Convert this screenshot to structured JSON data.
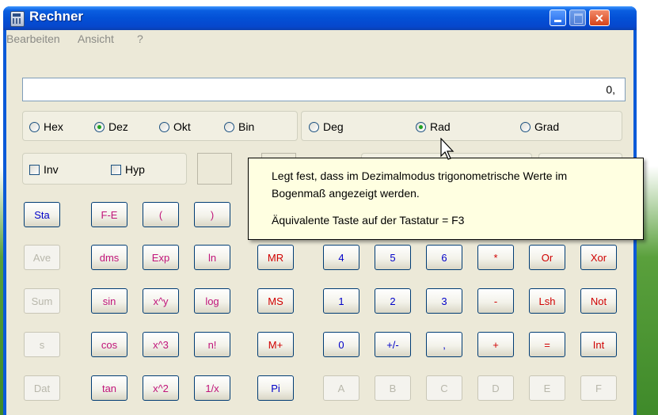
{
  "window": {
    "title": "Rechner"
  },
  "menu": [
    "Bearbeiten",
    "Ansicht",
    "?"
  ],
  "display_value": "0,",
  "number_system": {
    "options": [
      "Hex",
      "Dez",
      "Okt",
      "Bin"
    ],
    "selected": "Dez"
  },
  "angle_unit": {
    "options": [
      "Deg",
      "Rad",
      "Grad"
    ],
    "selected": "Rad"
  },
  "checkboxes": [
    "Inv",
    "Hyp"
  ],
  "buttons": {
    "stat_column": [
      "Sta",
      "Ave",
      "Sum",
      "s",
      "Dat"
    ],
    "func_row1": [
      "F-E",
      "(",
      ")"
    ],
    "func_row2": [
      "dms",
      "Exp",
      "ln"
    ],
    "func_row3": [
      "sin",
      "x^y",
      "log"
    ],
    "func_row4": [
      "cos",
      "x^3",
      "n!"
    ],
    "func_row5": [
      "tan",
      "x^2",
      "1/x"
    ],
    "memory": [
      "MR",
      "MS",
      "M+",
      "Pi"
    ],
    "digits_row1": [
      "4",
      "5",
      "6",
      "*",
      "Or",
      "Xor"
    ],
    "digits_row2": [
      "1",
      "2",
      "3",
      "-",
      "Lsh",
      "Not"
    ],
    "digits_row3": [
      "0",
      "+/-",
      ",",
      "+",
      "=",
      "Int"
    ],
    "hex_row": [
      "A",
      "B",
      "C",
      "D",
      "E",
      "F"
    ]
  },
  "tooltip": {
    "line1": "Legt fest, dass im Dezimalmodus trigonometrische Werte im",
    "line2": "Bogenmaß angezeigt werden.",
    "line3": "Äquivalente Taste auf der Tastatur = F3"
  }
}
